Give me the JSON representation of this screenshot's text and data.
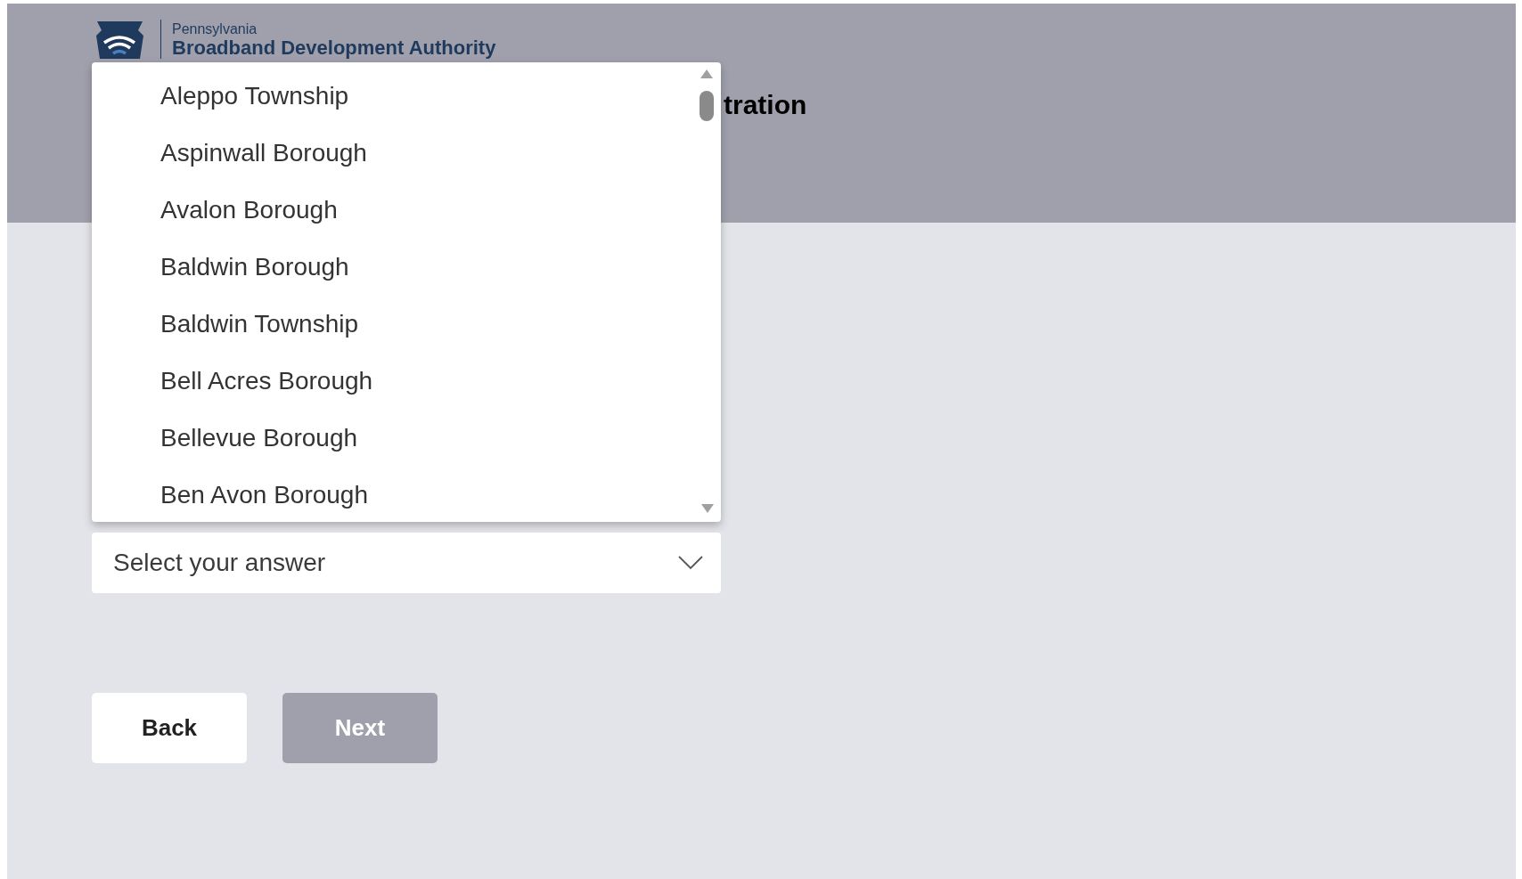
{
  "header": {
    "org_line_1": "Pennsylvania",
    "org_line_2": "Broadband Development Authority",
    "heading": "tration"
  },
  "dropdown": {
    "expanded": true,
    "options": [
      {
        "label": "Aleppo Township",
        "selected": false
      },
      {
        "label": "Aspinwall Borough",
        "selected": false
      },
      {
        "label": "Avalon Borough",
        "selected": false
      },
      {
        "label": "Baldwin Borough",
        "selected": false
      },
      {
        "label": "Baldwin Township",
        "selected": false
      },
      {
        "label": "Bell Acres Borough",
        "selected": false
      },
      {
        "label": "Bellevue Borough",
        "selected": false
      },
      {
        "label": "Ben Avon Borough",
        "selected": false
      }
    ]
  },
  "select": {
    "placeholder": "Select your answer"
  },
  "buttons": [
    {
      "label": "Back",
      "disabled": false
    },
    {
      "label": "Next",
      "disabled": true
    }
  ]
}
